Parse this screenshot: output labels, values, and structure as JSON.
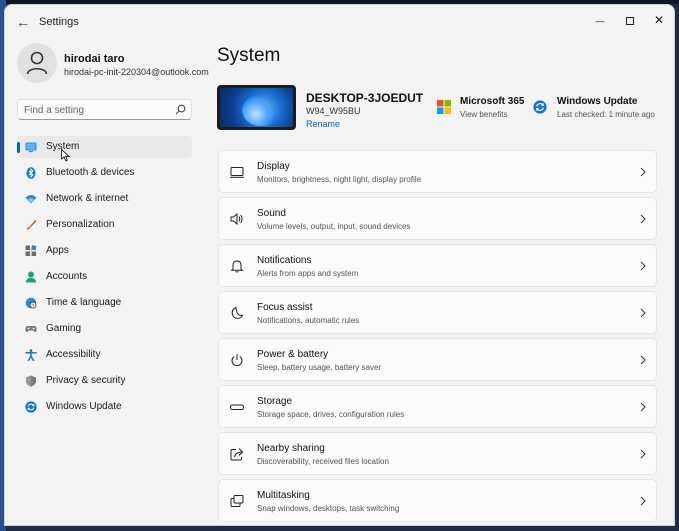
{
  "window": {
    "title": "Settings",
    "back_glyph": "←",
    "minimize_glyph": "—",
    "close_glyph": "✕"
  },
  "profile": {
    "name": "hirodai taro",
    "email": "hirodai-pc-init-220304@outlook.com"
  },
  "search": {
    "placeholder": "Find a setting",
    "value": ""
  },
  "nav": {
    "items": [
      {
        "label": "System",
        "icon": "system-icon",
        "selected": true
      },
      {
        "label": "Bluetooth & devices",
        "icon": "bluetooth-icon"
      },
      {
        "label": "Network & internet",
        "icon": "wifi-icon"
      },
      {
        "label": "Personalization",
        "icon": "brush-icon"
      },
      {
        "label": "Apps",
        "icon": "apps-icon"
      },
      {
        "label": "Accounts",
        "icon": "person-icon"
      },
      {
        "label": "Time & language",
        "icon": "globe-clock-icon"
      },
      {
        "label": "Gaming",
        "icon": "gamepad-icon"
      },
      {
        "label": "Accessibility",
        "icon": "accessibility-icon"
      },
      {
        "label": "Privacy & security",
        "icon": "shield-icon"
      },
      {
        "label": "Windows Update",
        "icon": "update-icon"
      }
    ]
  },
  "main": {
    "title": "System",
    "device": {
      "name": "DESKTOP-3JOEDUT",
      "model": "W94_W95BU",
      "rename_label": "Rename"
    },
    "microsoft365": {
      "title": "Microsoft 365",
      "subtitle": "View benefits"
    },
    "windows_update": {
      "title": "Windows Update",
      "subtitle": "Last checked: 1 minute ago"
    },
    "cards": [
      {
        "title": "Display",
        "subtitle": "Monitors, brightness, night light, display profile",
        "icon": "display-icon"
      },
      {
        "title": "Sound",
        "subtitle": "Volume levels, output, input, sound devices",
        "icon": "speaker-icon"
      },
      {
        "title": "Notifications",
        "subtitle": "Alerts from apps and system",
        "icon": "bell-icon"
      },
      {
        "title": "Focus assist",
        "subtitle": "Notifications, automatic rules",
        "icon": "moon-icon"
      },
      {
        "title": "Power & battery",
        "subtitle": "Sleep, battery usage, battery saver",
        "icon": "power-icon"
      },
      {
        "title": "Storage",
        "subtitle": "Storage space, drives, configuration rules",
        "icon": "storage-icon"
      },
      {
        "title": "Nearby sharing",
        "subtitle": "Discoverability, received files location",
        "icon": "share-icon"
      },
      {
        "title": "Multitasking",
        "subtitle": "Snap windows, desktops, task switching",
        "icon": "multitask-icon"
      }
    ]
  },
  "colors": {
    "accent": "#0067c0",
    "window_bg": "#f3f3f3",
    "card_bg": "#fbfbfb"
  }
}
